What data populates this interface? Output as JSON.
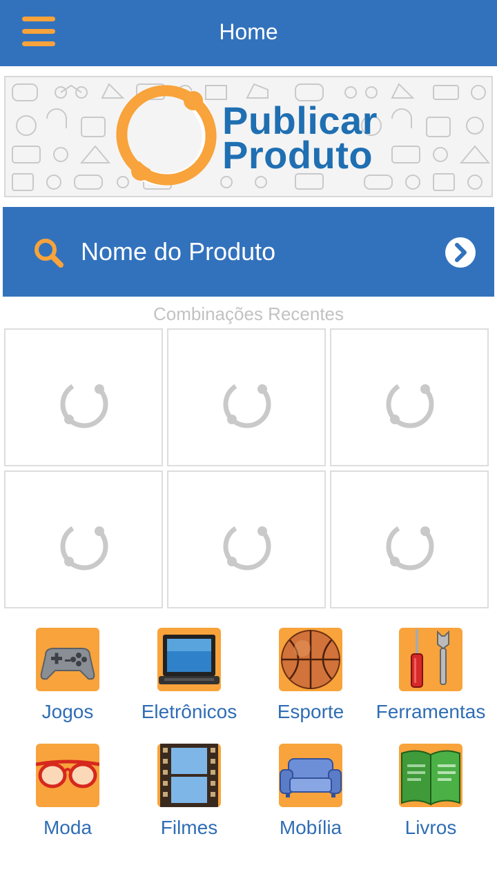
{
  "header": {
    "title": "Home",
    "menu_icon": "hamburger-menu-icon",
    "background_color": "#3272bd",
    "accent_color": "#f8a33b"
  },
  "banner": {
    "logo_line1": "Publicar",
    "logo_line2": "Produto",
    "logo_color": "#1f6fb2",
    "ring_color": "#f8a33b"
  },
  "search": {
    "placeholder": "Nome do Produto",
    "icon": "search-icon",
    "action_icon": "chevron-right-circle-icon"
  },
  "recent": {
    "title": "Combinações Recentes",
    "items": [
      {
        "state": "loading"
      },
      {
        "state": "loading"
      },
      {
        "state": "loading"
      },
      {
        "state": "loading"
      },
      {
        "state": "loading"
      },
      {
        "state": "loading"
      }
    ]
  },
  "categories": [
    {
      "label": "Jogos",
      "icon": "gamepad-icon"
    },
    {
      "label": "Eletrônicos",
      "icon": "laptop-icon"
    },
    {
      "label": "Esporte",
      "icon": "basketball-icon"
    },
    {
      "label": "Ferramentas",
      "icon": "tools-icon"
    },
    {
      "label": "Moda",
      "icon": "glasses-icon"
    },
    {
      "label": "Filmes",
      "icon": "film-strip-icon"
    },
    {
      "label": "Mobília",
      "icon": "sofa-icon"
    },
    {
      "label": "Livros",
      "icon": "book-icon"
    }
  ]
}
